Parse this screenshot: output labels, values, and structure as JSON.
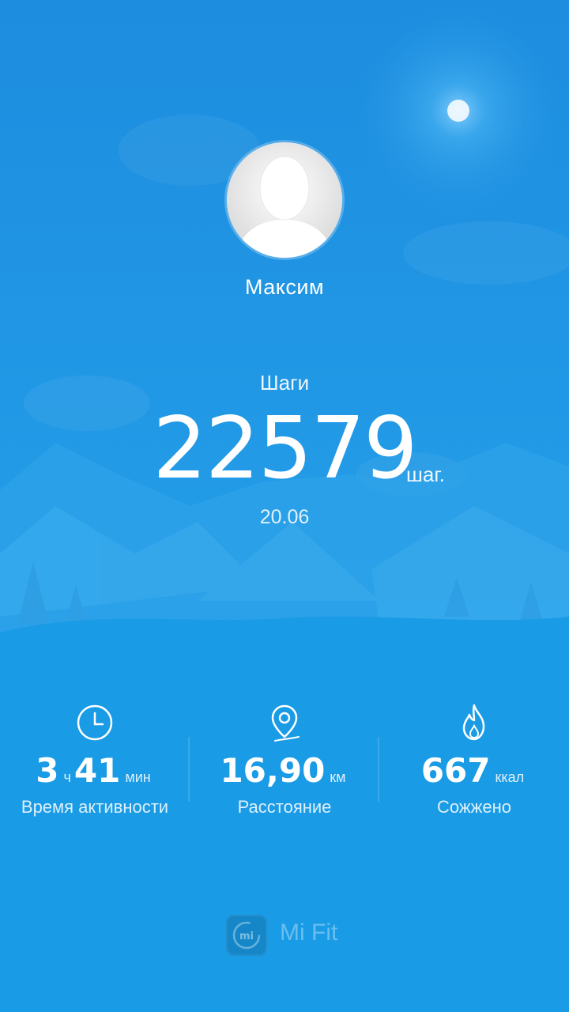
{
  "user": {
    "name": "Максим"
  },
  "steps": {
    "label": "Шаги",
    "value": "22579",
    "unit": "шаг.",
    "date": "20.06"
  },
  "stats": [
    {
      "icon": "clock-icon",
      "value_hours": "3",
      "unit_hours": "ч",
      "value_minutes": "41",
      "unit_minutes": "мин",
      "caption": "Время активности"
    },
    {
      "icon": "location-pin-icon",
      "value": "16,90",
      "unit": "км",
      "caption": "Расстояние"
    },
    {
      "icon": "flame-icon",
      "value": "667",
      "unit": "ккал",
      "caption": "Сожжено"
    }
  ],
  "brand": {
    "logo_text": "mi",
    "name": "Mi Fit"
  },
  "colors": {
    "background": "#1a9be6",
    "sky": "#1f8fe0",
    "mountains": "#3aa9ea"
  }
}
